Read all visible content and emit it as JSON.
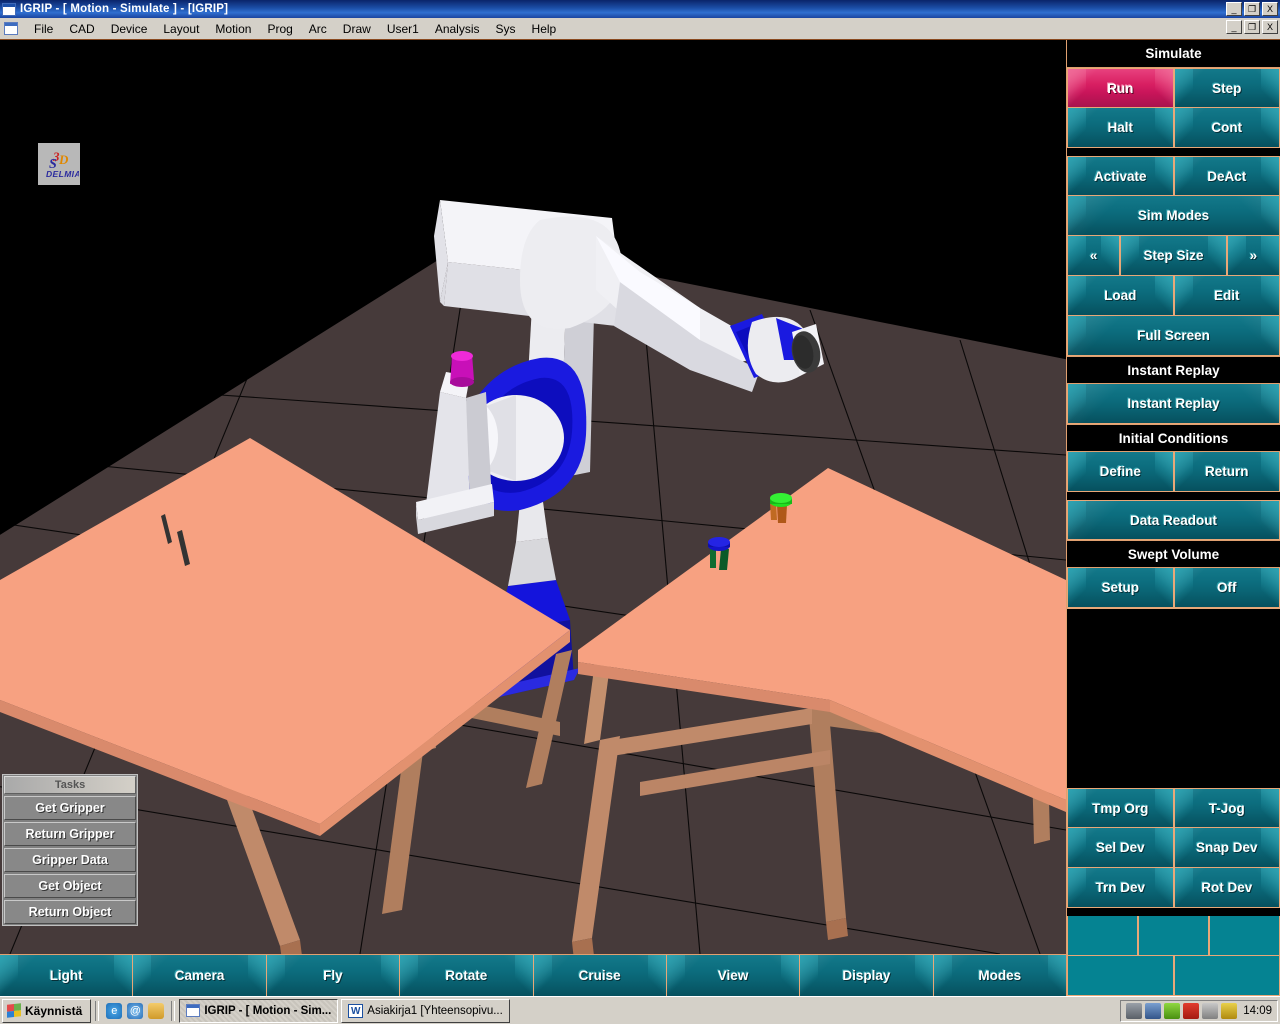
{
  "window": {
    "title": "IGRIP - [ Motion - Simulate ] - [IGRIP]",
    "icon": "window-icon",
    "controls": {
      "minimize": "_",
      "maximize": "❐",
      "close": "X"
    }
  },
  "menubar": {
    "items": [
      "File",
      "CAD",
      "Device",
      "Layout",
      "Motion",
      "Prog",
      "Arc",
      "Draw",
      "User1",
      "Analysis",
      "Sys",
      "Help"
    ]
  },
  "viewport": {
    "logo_text": "DELMIA",
    "logo_mark": "3DS",
    "background": "#000000",
    "floor_color": "#463a3a",
    "table_top_color": "#f7a181",
    "table_leg_color": "#c08a6a",
    "robot_body_color": "#e8e8ec",
    "robot_joint_color": "#1414dc",
    "objects": [
      {
        "name": "green-puck",
        "cap_color": "#20e020",
        "leg_color": "#b05818"
      },
      {
        "name": "blue-puck",
        "cap_color": "#1414c8",
        "leg_color": "#0a5a28"
      },
      {
        "name": "magenta-cap",
        "color": "#d010c0"
      }
    ]
  },
  "tasks_panel": {
    "title": "Tasks",
    "buttons": [
      "Get Gripper",
      "Return Gripper",
      "Gripper Data",
      "Get Object",
      "Return Object"
    ]
  },
  "bottom_toolbar": {
    "buttons": [
      "Light",
      "Camera",
      "Fly",
      "Rotate",
      "Cruise",
      "View",
      "Display",
      "Modes"
    ]
  },
  "right_panel": {
    "accent_teal": "#0a6c7d",
    "accent_pink": "#d0175e",
    "border_color": "#e8a878",
    "header": "Simulate",
    "groups": [
      {
        "name": "simulate-controls",
        "rows": [
          {
            "type": "pair",
            "buttons": [
              {
                "label": "Run",
                "style": "pink",
                "active": true
              },
              {
                "label": "Step",
                "style": "teal",
                "active": false
              }
            ]
          },
          {
            "type": "pair",
            "buttons": [
              {
                "label": "Halt",
                "style": "teal",
                "active": false
              },
              {
                "label": "Cont",
                "style": "teal",
                "active": false
              }
            ]
          }
        ]
      },
      {
        "name": "device-controls",
        "rows": [
          {
            "type": "pair",
            "buttons": [
              {
                "label": "Activate",
                "style": "teal"
              },
              {
                "label": "DeAct",
                "style": "teal"
              }
            ]
          },
          {
            "type": "single",
            "buttons": [
              {
                "label": "Sim Modes",
                "style": "teal"
              }
            ]
          },
          {
            "type": "triple",
            "buttons": [
              {
                "label": "«",
                "style": "teal",
                "icon": "prev-icon"
              },
              {
                "label": "Step Size",
                "style": "teal"
              },
              {
                "label": "»",
                "style": "teal",
                "icon": "next-icon"
              }
            ]
          },
          {
            "type": "pair",
            "buttons": [
              {
                "label": "Load",
                "style": "teal"
              },
              {
                "label": "Edit",
                "style": "teal"
              }
            ]
          },
          {
            "type": "single",
            "buttons": [
              {
                "label": "Full Screen",
                "style": "teal"
              }
            ]
          }
        ]
      },
      {
        "name": "instant-replay",
        "heading": "Instant Replay",
        "rows": [
          {
            "type": "single",
            "buttons": [
              {
                "label": "Instant Replay",
                "style": "teal"
              }
            ]
          }
        ]
      },
      {
        "name": "initial-conditions",
        "heading": "Initial Conditions",
        "rows": [
          {
            "type": "pair",
            "buttons": [
              {
                "label": "Define",
                "style": "teal"
              },
              {
                "label": "Return",
                "style": "teal"
              }
            ]
          }
        ]
      },
      {
        "name": "data-readout",
        "rows": [
          {
            "type": "single",
            "buttons": [
              {
                "label": "Data Readout",
                "style": "teal"
              }
            ]
          }
        ]
      },
      {
        "name": "swept-volume",
        "heading": "Swept Volume",
        "rows": [
          {
            "type": "pair",
            "buttons": [
              {
                "label": "Setup",
                "style": "teal"
              },
              {
                "label": "Off",
                "style": "teal"
              }
            ]
          }
        ]
      },
      {
        "name": "device-jog",
        "rows": [
          {
            "type": "pair",
            "buttons": [
              {
                "label": "Tmp Org",
                "style": "teal"
              },
              {
                "label": "T-Jog",
                "style": "teal"
              }
            ]
          },
          {
            "type": "pair",
            "buttons": [
              {
                "label": "Sel Dev",
                "style": "teal"
              },
              {
                "label": "Snap Dev",
                "style": "teal"
              }
            ]
          },
          {
            "type": "pair",
            "buttons": [
              {
                "label": "Trn Dev",
                "style": "teal"
              },
              {
                "label": "Rot Dev",
                "style": "teal"
              }
            ]
          }
        ]
      }
    ],
    "empty_rows": [
      {
        "count": 3,
        "labels": [
          "",
          "",
          ""
        ]
      },
      {
        "count": 2,
        "labels": [
          "",
          ""
        ]
      }
    ]
  },
  "taskbar": {
    "start_label": "Käynnistä",
    "quick_launch": [
      "internet-explorer-icon",
      "outlook-express-icon",
      "folder-icon"
    ],
    "tasks": [
      {
        "label": "IGRIP - [ Motion - Sim...",
        "icon": "igrip-icon",
        "active": true
      },
      {
        "label": "Asiakirja1 [Yhteensopivu...",
        "icon": "word-icon",
        "active": false
      }
    ],
    "tray_icons": [
      "printer-icon",
      "network-icon",
      "antivirus-icon",
      "ati-icon",
      "safely-remove-icon",
      "volume-icon"
    ],
    "clock": "14:09"
  }
}
